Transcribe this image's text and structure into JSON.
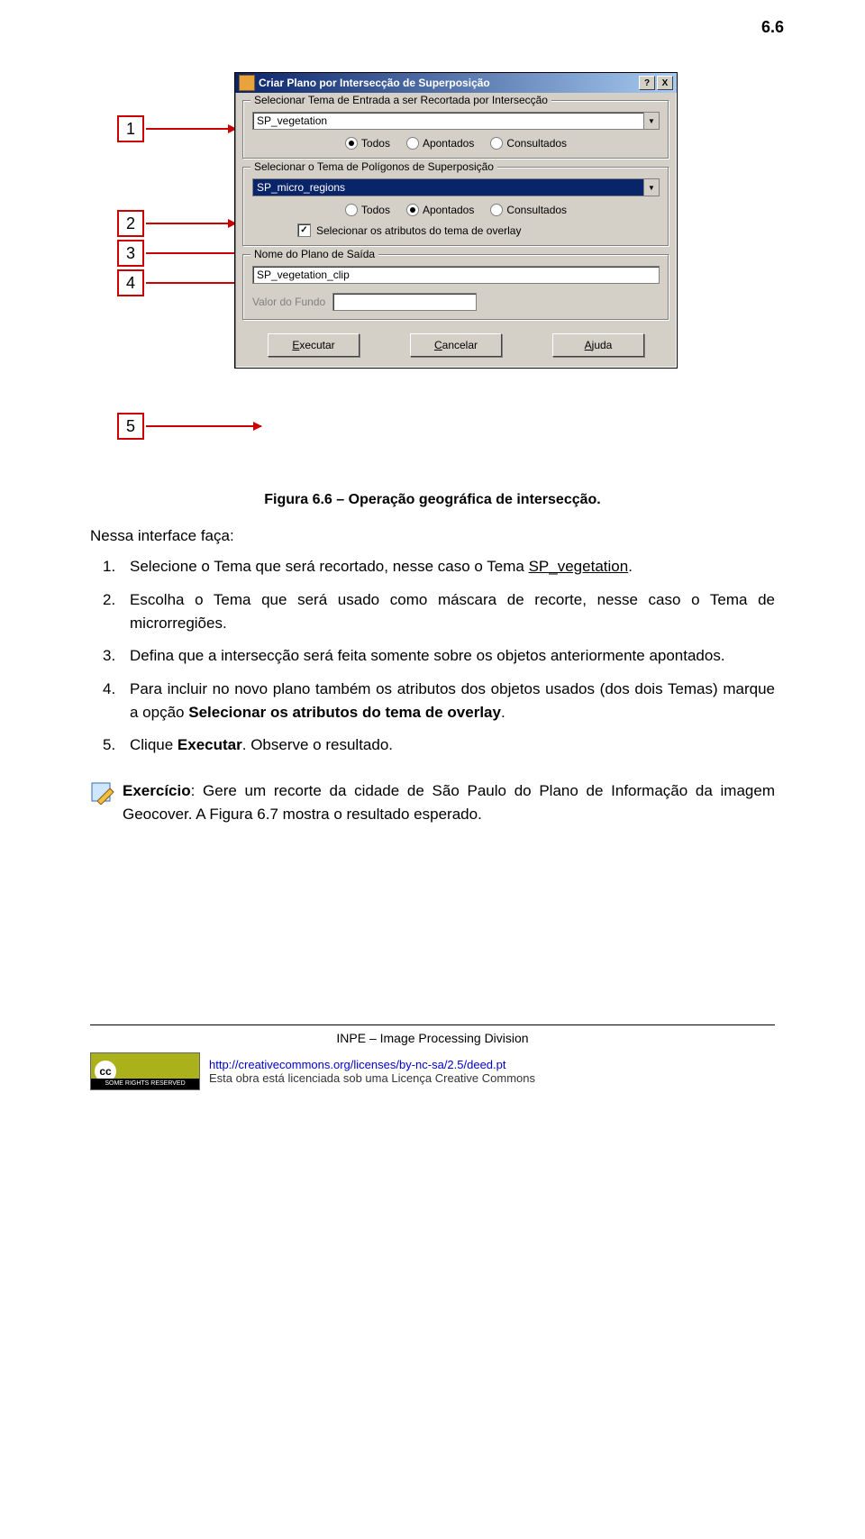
{
  "header_number": "6.6",
  "callouts": [
    "1",
    "2",
    "3",
    "4",
    "5"
  ],
  "dialog": {
    "title": "Criar Plano por Intersecção de Superposição",
    "help_btn": "?",
    "close_btn": "X",
    "group1": {
      "legend": "Selecionar Tema de Entrada a ser Recortada por Intersecção",
      "dropdown_value": "SP_vegetation",
      "radios": {
        "todos": "Todos",
        "apontados": "Apontados",
        "consultados": "Consultados"
      }
    },
    "group2": {
      "legend": "Selecionar o Tema de Polígonos de Superposição",
      "dropdown_value": "SP_micro_regions",
      "radios": {
        "todos": "Todos",
        "apontados": "Apontados",
        "consultados": "Consultados"
      },
      "checkbox_label": "Selecionar os atributos do tema de overlay"
    },
    "group3": {
      "legend": "Nome do Plano de Saída",
      "input_value": "SP_vegetation_clip",
      "valor_fundo_label": "Valor do Fundo"
    },
    "buttons": {
      "executar": "Executar",
      "cancelar": "Cancelar",
      "ajuda": "Ajuda"
    }
  },
  "caption": "Figura 6.6 – Operação geográfica de intersecção.",
  "intro": "Nessa interface faça:",
  "steps": {
    "s1a": "Selecione o Tema que será recortado, nesse caso o Tema ",
    "s1b": "SP_vegetation",
    "s1c": ".",
    "s2": "Escolha o Tema que será usado como máscara de recorte, nesse caso o Tema de microrregiões.",
    "s3": "Defina que a intersecção será feita somente sobre os objetos anteriormente apontados.",
    "s4a": "Para incluir no novo plano também os atributos dos objetos usados (dos dois Temas) marque a opção ",
    "s4b": "Selecionar os atributos do tema de overlay",
    "s4c": ".",
    "s5a": "Clique ",
    "s5b": "Executar",
    "s5c": ". Observe o resultado."
  },
  "exercise": {
    "label": "Exercício",
    "text": ": Gere um recorte da cidade de São Paulo do Plano de Informação da imagem Geocover. A Figura 6.7 mostra o resultado esperado."
  },
  "footer": {
    "division": "INPE – Image Processing Division",
    "cc_badge": "SOME RIGHTS RESERVED",
    "cc_symbol": "cc",
    "cc_url": "http://creativecommons.org/licenses/by-nc-sa/2.5/deed.pt",
    "cc_text": "Esta obra está licenciada sob uma Licença Creative Commons"
  }
}
